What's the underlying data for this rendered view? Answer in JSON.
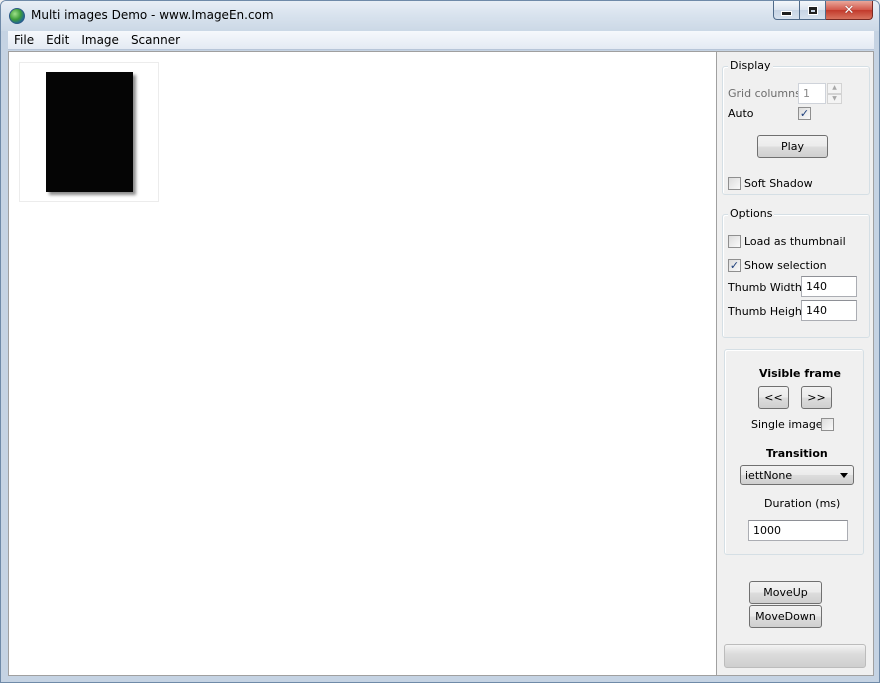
{
  "window": {
    "title": "Multi images Demo - www.ImageEn.com"
  },
  "menu": {
    "items": [
      "File",
      "Edit",
      "Image",
      "Scanner"
    ]
  },
  "display": {
    "title": "Display",
    "grid_columns_label": "Grid columns:",
    "grid_columns_value": "1",
    "auto_label": "Auto",
    "auto_checked": true,
    "play_label": "Play",
    "soft_shadow_label": "Soft Shadow",
    "soft_shadow_checked": false
  },
  "options": {
    "title": "Options",
    "load_as_thumbnail_label": "Load as thumbnail",
    "load_as_thumbnail_checked": false,
    "show_selection_label": "Show selection",
    "show_selection_checked": true,
    "thumb_width_label": "Thumb Width",
    "thumb_width_value": "140",
    "thumb_height_label": "Thumb Height",
    "thumb_height_value": "140"
  },
  "frame": {
    "visible_frame_label": "Visible frame",
    "prev_label": "<<",
    "next_label": ">>",
    "single_image_label": "Single image",
    "single_image_checked": false,
    "transition_label": "Transition",
    "transition_value": "iettNone",
    "duration_label": "Duration (ms)",
    "duration_value": "1000"
  },
  "order": {
    "move_up_label": "MoveUp",
    "move_down_label": "MoveDown"
  },
  "progress": {
    "value": 0
  },
  "icons": {
    "app": "globe-icon",
    "minimize": "minimize-icon",
    "maximize": "maximize-icon",
    "close": "close-icon",
    "check": "check-icon",
    "dropdown": "chevron-down-icon"
  }
}
